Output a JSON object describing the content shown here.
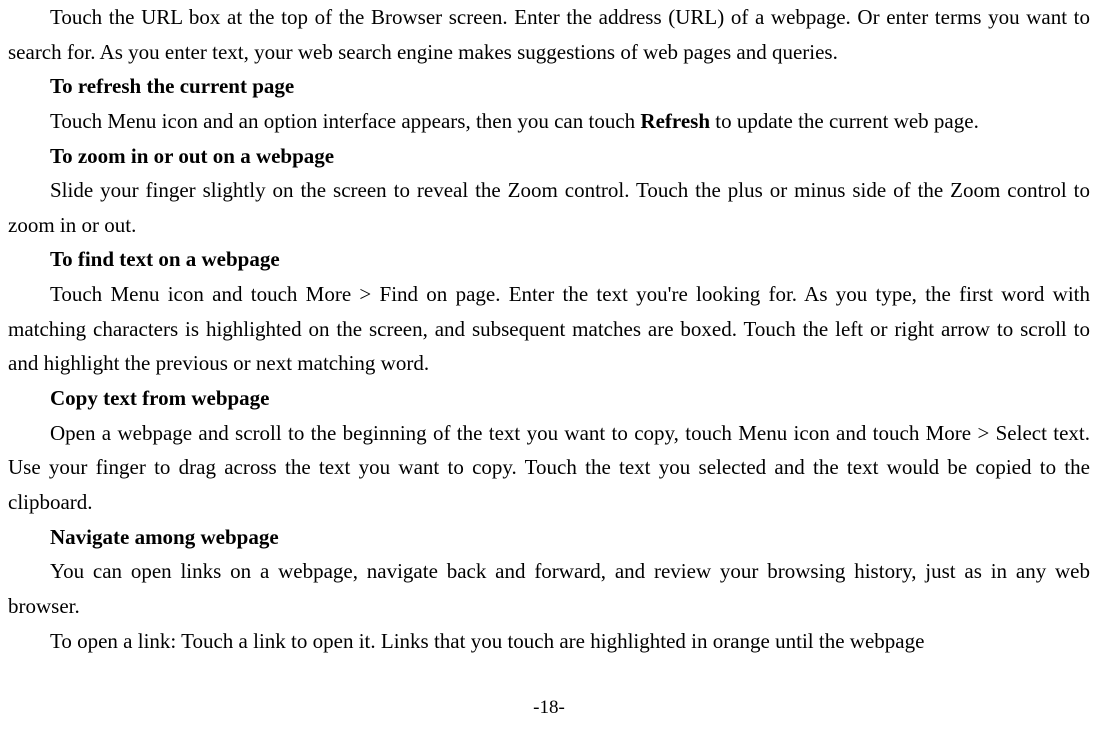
{
  "page": {
    "intro": "Touch the URL box at the top of the Browser screen. Enter the address (URL) of a webpage. Or enter terms you want to search for. As you enter text, your web search engine makes suggestions of web pages and queries.",
    "sections": [
      {
        "heading": "To refresh the current page",
        "body_pre": "Touch Menu icon and an option interface appears, then you can touch ",
        "body_bold": "Refresh",
        "body_post": " to update the current web page."
      },
      {
        "heading": "To zoom in or out on a webpage",
        "body": "Slide your finger slightly on the screen to reveal the Zoom control. Touch the plus or minus side of the Zoom control to zoom in or out."
      },
      {
        "heading": "To find text on a webpage",
        "body": "Touch Menu icon and touch More > Find on page. Enter the text you're looking for. As you type, the first word with matching characters is highlighted on the screen, and subsequent matches are boxed. Touch the left or right arrow to scroll to and highlight the previous or next matching word."
      },
      {
        "heading": "Copy text from webpage",
        "body": "Open a webpage and scroll to the beginning of the text you want to copy, touch Menu icon and touch More > Select text. Use your finger to drag across the text you want to copy. Touch the text you selected and the text would be copied to the clipboard."
      },
      {
        "heading": "Navigate among webpage",
        "body": "You can open links on a webpage, navigate back and forward, and review your browsing history, just as in any web browser."
      }
    ],
    "open_link": "To open a link: Touch a link to open it. Links that you touch are highlighted in orange until the webpage",
    "number": "-18-"
  }
}
